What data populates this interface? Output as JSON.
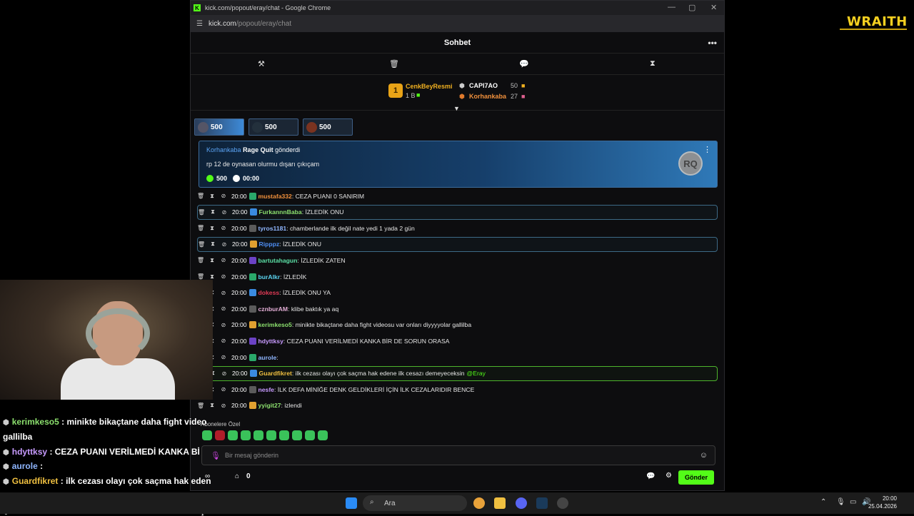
{
  "logo": {
    "text": "WRAITH"
  },
  "window": {
    "title": "kick.com/popout/eray/chat - Google Chrome",
    "url_host": "kick.com",
    "url_path": "/popout/eray/chat"
  },
  "chat": {
    "title": "Sohbet",
    "top_gifters": {
      "first_rank": "1",
      "first_name": "CenkBeyResmi",
      "first_amount": "1 B",
      "second_name": "CAPI7AO",
      "second_amount": "50",
      "third_name": "Korhankaba",
      "third_amount": "27"
    },
    "pinned": [
      {
        "amount": "500"
      },
      {
        "amount": "500"
      },
      {
        "amount": "500"
      }
    ],
    "banner": {
      "user": "Korhankaba",
      "item": "Rage Quit",
      "action": "gönderdi",
      "message": "rp 12 de oynasan olurmu dışarı çıkıçam",
      "amount": "500",
      "time": "00:00",
      "coin_label": "RQ"
    },
    "messages": [
      {
        "time": "20:00",
        "user": "mustafa332",
        "color": "#f0903c",
        "text": "CEZA PUANI 0 SANIRIM"
      },
      {
        "time": "20:00",
        "user": "FurkannnBaba",
        "color": "#8ce06e",
        "text": "İZLEDİK ONU"
      },
      {
        "time": "20:00",
        "user": "tyros1181",
        "color": "#8fb6ff",
        "text": "chamberlande ilk değil nate yedi 1 yada 2 gün"
      },
      {
        "time": "20:00",
        "user": "Ripppz",
        "color": "#4f8ff5",
        "text": "İZLEDİK ONU"
      },
      {
        "time": "20:00",
        "user": "bartutahagun",
        "color": "#5be0a6",
        "text": "İZLEDİK ZATEN"
      },
      {
        "time": "20:00",
        "user": "burAlkr",
        "color": "#5bd4f0",
        "text": "İZLEDİK"
      },
      {
        "time": "20:00",
        "user": "dokess",
        "color": "#e03a55",
        "text": "İZLEDİK ONU YA"
      },
      {
        "time": "20:00",
        "user": "cznburAM",
        "color": "#e6b0d8",
        "text": "klibe baktık ya aq"
      },
      {
        "time": "20:00",
        "user": "kerimkeso5",
        "color": "#8ce06e",
        "text": "minikte bikaçtane daha fight videosu var onları diyyyyolar gallilba"
      },
      {
        "time": "20:00",
        "user": "hdyttksy",
        "color": "#c89bff",
        "text": "CEZA PUANI VERİLMEDİ KANKA BİR DE SORUN ORASA"
      },
      {
        "time": "20:00",
        "user": "aurole",
        "color": "#8fb6ff",
        "text": ""
      },
      {
        "time": "20:00",
        "user": "Guardfikret",
        "color": "#f0c040",
        "text": "ilk cezası olayı çok saçma hak edene ilk cesazı demeyeceksin",
        "mention": "@Eray"
      },
      {
        "time": "20:00",
        "user": "nesfe",
        "color": "#c89bff",
        "text": "İLK DEFA MİNİĞE DENK GELDİKLERİ İÇİN İLK CEZALARIDIR BENCE"
      },
      {
        "time": "20:00",
        "user": "yyigit27",
        "color": "#8ce06e",
        "text": "izlendi"
      }
    ],
    "subscribers_label": "Abonelere Özel",
    "input_placeholder": "Bir mesaj gönderin",
    "points": "0",
    "send_label": "Gönder"
  },
  "overlay_chat": [
    {
      "user": "kerimkeso5",
      "text": ": minikte bikaçtane daha fight video",
      "color": "#8ce06e"
    },
    {
      "user": "",
      "text": "gallilba",
      "color": "#ffffff"
    },
    {
      "user": "hdyttksy",
      "text": ": CEZA PUANI VERİLMEDİ KANKA Bİ",
      "color": "#c89bff"
    },
    {
      "user": "aurole",
      "text": ":",
      "color": "#8fb6ff"
    },
    {
      "user": "Guardfikret",
      "text": ": ilk cezası olayı çok saçma hak eden",
      "color": "#f0c040"
    },
    {
      "user": "",
      "text": "@Eray",
      "color": "#8fb6ff"
    },
    {
      "user": "nesfe",
      "text": ": İLK DEFA MİNİĞE DENK GELDİKLERİ İÇİN",
      "color": "#c89bff"
    }
  ],
  "taskbar": {
    "search_label": "Ara",
    "time": "20:00",
    "date": "25.04.2026"
  }
}
